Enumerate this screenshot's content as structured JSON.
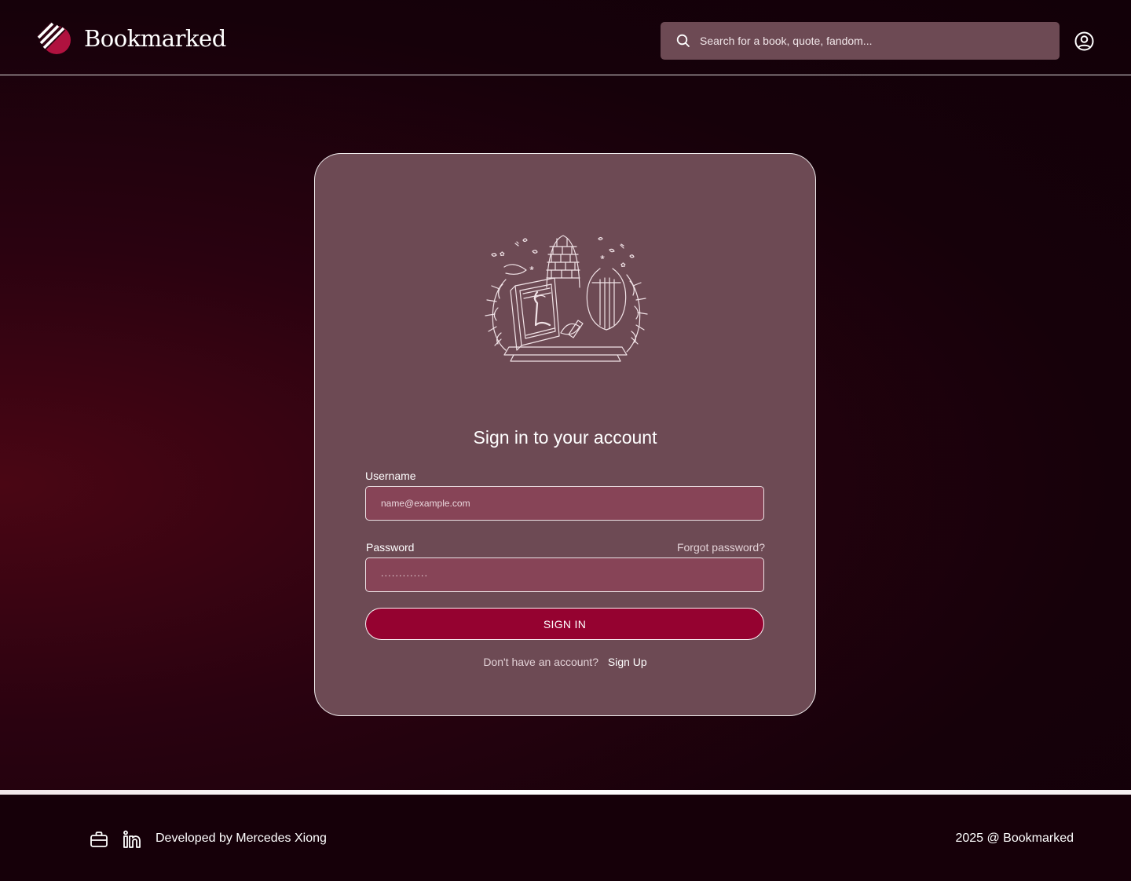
{
  "header": {
    "brand": "Bookmarked",
    "search_placeholder": "Search for a book, quote, fandom...",
    "account_icon": "user-circle-icon"
  },
  "login": {
    "title": "Sign in to your account",
    "emblem_letter": "L",
    "username_label": "Username",
    "username_placeholder": "name@example.com",
    "password_label": "Password",
    "password_value": ".............",
    "forgot_label": "Forgot password?",
    "signin_label": "SIGN IN",
    "no_account_text": "Don't have an account?",
    "signup_label": "Sign Up"
  },
  "footer": {
    "icons": [
      "briefcase-icon",
      "linkedin-icon"
    ],
    "credit": "Developed by Mercedes Xiong",
    "copyright": "2025 @ Bookmarked"
  },
  "colors": {
    "background": "#2a0210",
    "card": "#6d4a54",
    "input": "#874457",
    "primary_button": "#950230",
    "logo_accent": "#b0123f"
  }
}
